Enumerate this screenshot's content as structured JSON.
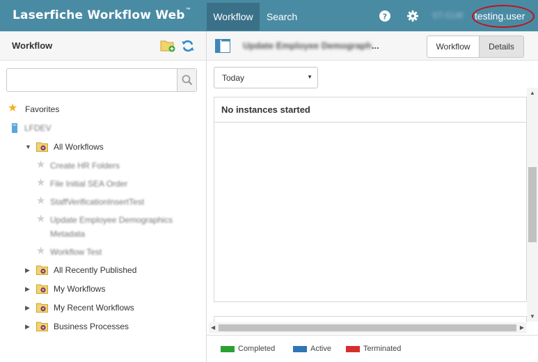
{
  "header": {
    "brand": "Laserfiche Workflow Web",
    "brand_tm": "™",
    "tabs": [
      {
        "label": "Workflow",
        "active": true
      },
      {
        "label": "Search",
        "active": false
      }
    ],
    "user_prefix_blurred": "ST-CLW",
    "user_name": "testing.user",
    "accent_color": "#4a8ba4",
    "highlight_color": "#c0121c"
  },
  "left_panel": {
    "title": "Workflow",
    "search": {
      "value": "",
      "placeholder": ""
    },
    "tree": {
      "favorites": "Favorites",
      "server": "LFDEV",
      "all_workflows": "All Workflows",
      "workflows": [
        "Create HR Folders",
        "File Initial SEA Order",
        "StaffVerificationInsertTest",
        "Update Employee Demographics",
        "Metadata",
        "Workflow Test"
      ],
      "folders": [
        "All Recently Published",
        "My Workflows",
        "My Recent Workflows",
        "Business Processes"
      ]
    }
  },
  "right_panel": {
    "workflow_title": "Update Employee Demograph",
    "title_suffix": "...",
    "view_buttons": {
      "workflow": "Workflow",
      "details": "Details"
    },
    "date_filter": "Today",
    "grid_message": "No instances started",
    "legend": [
      {
        "label": "Completed",
        "color": "#2ba132"
      },
      {
        "label": "Active",
        "color": "#2f76b5"
      },
      {
        "label": "Terminated",
        "color": "#d42f2c"
      }
    ]
  }
}
